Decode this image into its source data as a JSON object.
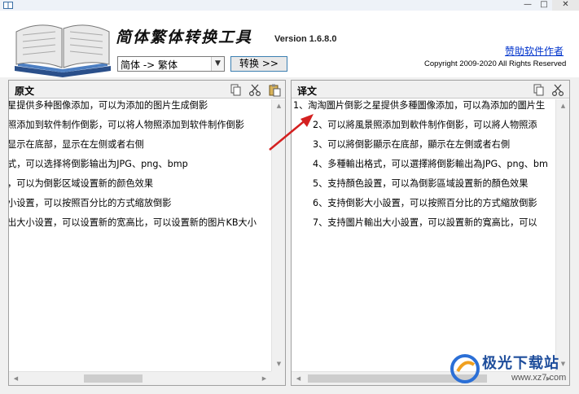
{
  "window": {
    "icon": "book-app-icon",
    "controls": {
      "minimize": "—",
      "maximize": "□",
      "close": "✕"
    }
  },
  "header": {
    "logo": "open-book-logo",
    "app_title": "简体繁体转换工具",
    "version": "Version 1.6.8.0",
    "sponsor_link": "赞助软件作者",
    "copyright": "Copyright 2009-2020 All Rights Reserved"
  },
  "toolbar": {
    "mode_value": "简体 -> 繁体",
    "convert_label": "转换 >>"
  },
  "source_pane": {
    "title": "原文",
    "tools": [
      "copy-icon",
      "cut-icon",
      "paste-icon"
    ],
    "lines": [
      "星提供多种图像添加，可以为添加的图片生成倒影",
      "照添加到软件制作倒影，可以将人物照添加到软件制作倒影",
      "显示在底部，显示在左侧或者右侧",
      "式，可以选择将倒影输出为JPG、png、bmp",
      "，可以为倒影区域设置新的颜色效果",
      "小设置，可以按照百分比的方式缩放倒影",
      "出大小设置，可以设置新的宽高比，可以设置新的图片KB大小"
    ]
  },
  "target_pane": {
    "title": "译文",
    "tools": [
      "copy-icon",
      "cut-icon"
    ],
    "lines": [
      "1、淘淘圖片倒影之星提供多種圖像添加，可以為添加的圖片生",
      "2、可以將風景照添加到軟件制作倒影，可以將人物照添",
      "3、可以將倒影顯示在底部，顯示在左側或者右側",
      "4、多種輸出格式，可以選擇將倒影輸出為JPG、png、bm",
      "5、支持顏色設置，可以為倒影區域設置新的顏色效果",
      "6、支持倒影大小設置，可以按照百分比的方式縮放倒影",
      "7、支持圖片輸出大小設置，可以設置新的寬高比，可以"
    ]
  },
  "watermark": {
    "text": "极光下载站",
    "url": "www.xz7.com"
  },
  "colors": {
    "link": "#0033cc",
    "arrow": "#d42020",
    "border": "#a0a0a0"
  }
}
